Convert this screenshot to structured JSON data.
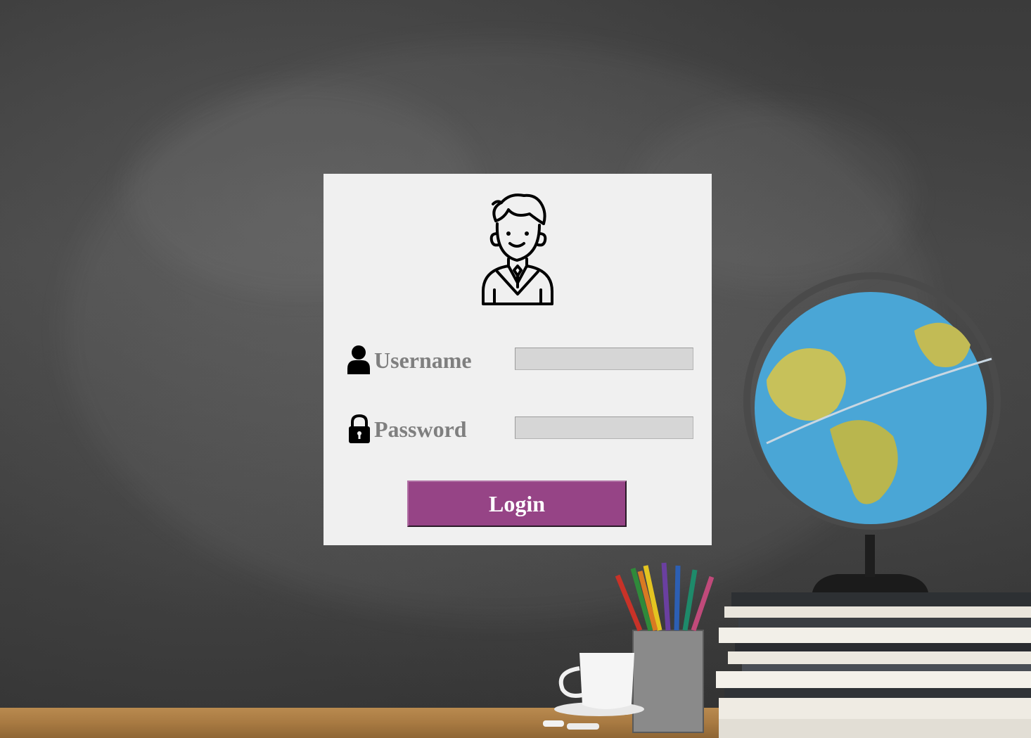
{
  "login_form": {
    "username_label": "Username",
    "password_label": "Password",
    "username_value": "",
    "password_value": "",
    "login_button_label": "Login"
  },
  "icons": {
    "avatar": "student-avatar-icon",
    "username": "user-icon",
    "password": "lock-icon"
  },
  "colors": {
    "card_background": "#f0f0f0",
    "button_background": "#964486",
    "label_text": "#7f7f7f",
    "input_background": "#d6d6d6"
  }
}
